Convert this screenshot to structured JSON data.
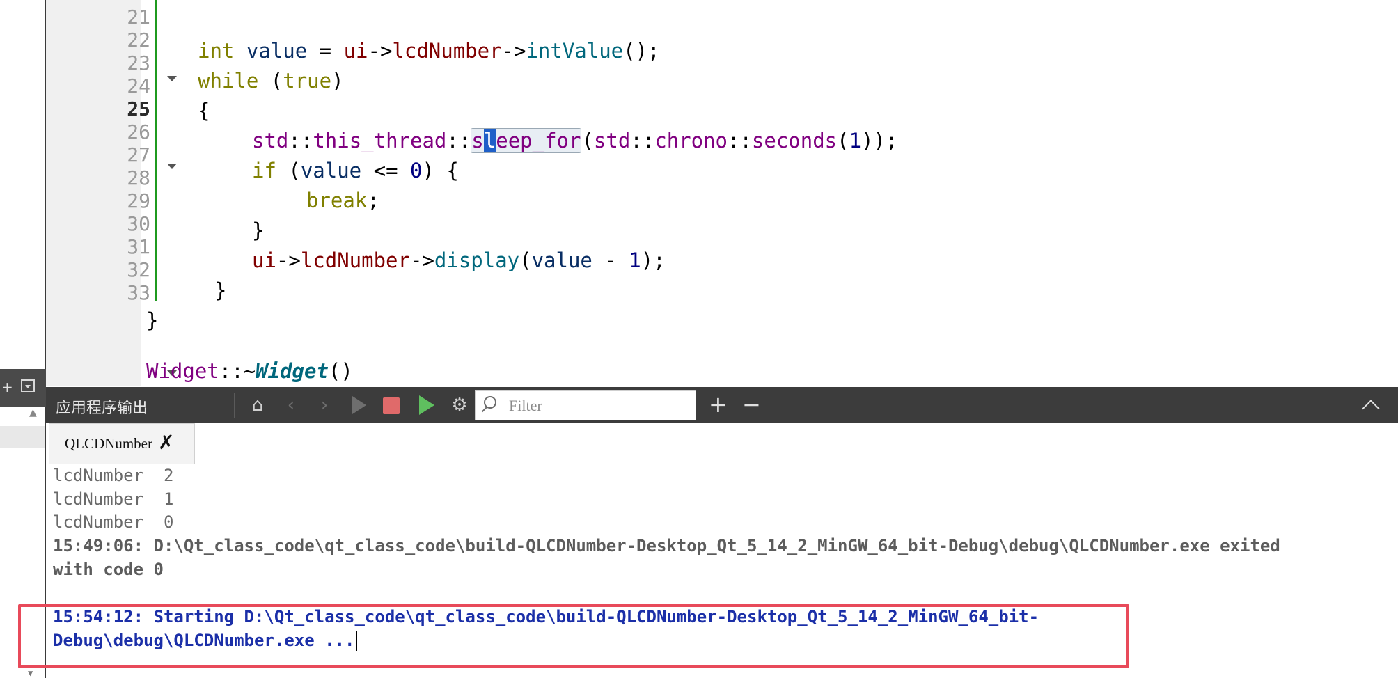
{
  "editor": {
    "current_line": "25",
    "lines": [
      {
        "n": "21"
      },
      {
        "n": "22"
      },
      {
        "n": "23"
      },
      {
        "n": "24"
      },
      {
        "n": "25"
      },
      {
        "n": "26"
      },
      {
        "n": "27"
      },
      {
        "n": "28"
      },
      {
        "n": "29"
      },
      {
        "n": "30"
      },
      {
        "n": "31"
      },
      {
        "n": "32"
      },
      {
        "n": "33"
      }
    ],
    "code": {
      "l22_kw": "int",
      "l22_var": "value",
      "l22_eq": " = ",
      "l22_ui": "ui",
      "l22_arrow1": "->",
      "l22_mem": "lcdNumber",
      "l22_arrow2": "->",
      "l22_fn": "intValue",
      "l22_end": "();",
      "l23_kw": "while",
      "l23_open": " (",
      "l23_true": "true",
      "l23_close": ")",
      "l24": "{",
      "l25_std1": "std",
      "l25_sep1": "::",
      "l25_thread": "this_thread",
      "l25_sep2": "::",
      "l25_fn_s": "s",
      "l25_fn_l": "l",
      "l25_fn_rest": "eep_for",
      "l25_paren": "(",
      "l25_std2": "std",
      "l25_sep3": "::",
      "l25_chrono": "chrono",
      "l25_sep4": "::",
      "l25_seconds": "seconds",
      "l25_p2": "(",
      "l25_num": "1",
      "l25_end": "));",
      "l26_kw": "if",
      "l26_open": " (",
      "l26_var": "value",
      "l26_op": " <= ",
      "l26_num": "0",
      "l26_end": ") {",
      "l27_kw": "break",
      "l27_end": ";",
      "l28": "}",
      "l29_ui": "ui",
      "l29_arrow1": "->",
      "l29_mem": "lcdNumber",
      "l29_arrow2": "->",
      "l29_fn": "display",
      "l29_open": "(",
      "l29_var": "value",
      "l29_op": " - ",
      "l29_num": "1",
      "l29_end": ");",
      "l30": "}",
      "l31": "}",
      "l33_cls": "Widget",
      "l33_sep": "::~",
      "l33_fn": "Widget",
      "l33_end": "()"
    }
  },
  "output_pane": {
    "title": "应用程序输出",
    "filter_placeholder": "Filter",
    "add_label": "+",
    "remove_label": "−",
    "tab_label": "QLCDNumber",
    "lines": [
      "lcdNumber  2",
      "lcdNumber  1",
      "lcdNumber  0",
      "15:49:06: D:\\Qt_class_code\\qt_class_code\\build-QLCDNumber-Desktop_Qt_5_14_2_MinGW_64_bit-Debug\\debug\\QLCDNumber.exe exited",
      "with code 0",
      "15:54:12: Starting D:\\Qt_class_code\\qt_class_code\\build-QLCDNumber-Desktop_Qt_5_14_2_MinGW_64_bit-",
      "Debug\\debug\\QLCDNumber.exe ..."
    ]
  },
  "colors": {
    "keyword": "#808000",
    "function": "#00677c",
    "member": "#800000",
    "type": "#800080",
    "number": "#000080",
    "highlight_box": "#e84a5a",
    "output_blue": "#1b2fa8"
  },
  "icons": {
    "left_add": "plus-icon",
    "left_dropdown": "dropdown-icon",
    "clear": "broom-icon",
    "prev": "chevron-left-icon",
    "next": "chevron-right-icon",
    "run": "play-icon",
    "stop": "stop-icon",
    "run_debug": "run-debug-icon",
    "settings": "gear-icon",
    "filter": "search-icon",
    "collapse": "chevron-up-icon",
    "tab_close": "close-icon"
  }
}
